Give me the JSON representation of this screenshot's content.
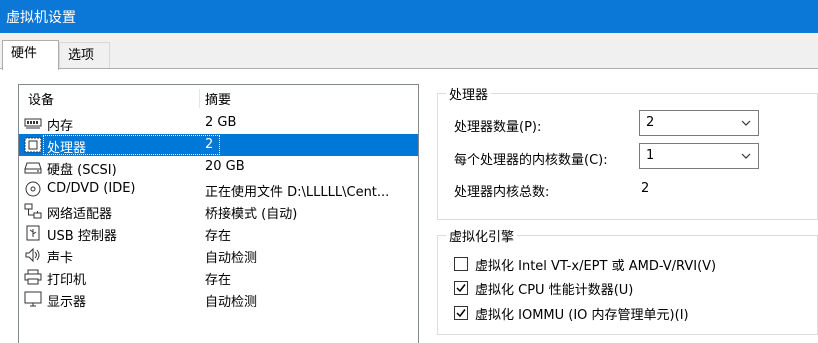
{
  "window": {
    "title": "虚拟机设置"
  },
  "tabs": [
    {
      "label": "硬件"
    },
    {
      "label": "选项"
    }
  ],
  "device_list": {
    "headers": {
      "device": "设备",
      "summary": "摘要"
    },
    "rows": [
      {
        "name": "内存",
        "summary": "2 GB",
        "icon": "memory-icon"
      },
      {
        "name": "处理器",
        "summary": "2",
        "icon": "processor-icon"
      },
      {
        "name": "硬盘 (SCSI)",
        "summary": "20 GB",
        "icon": "hard-disk-icon"
      },
      {
        "name": "CD/DVD (IDE)",
        "summary": "正在使用文件 D:\\LLLLL\\Cent...",
        "icon": "cd-dvd-icon"
      },
      {
        "name": "网络适配器",
        "summary": "桥接模式 (自动)",
        "icon": "network-adapter-icon"
      },
      {
        "name": "USB 控制器",
        "summary": "存在",
        "icon": "usb-controller-icon"
      },
      {
        "name": "声卡",
        "summary": "自动检测",
        "icon": "sound-card-icon"
      },
      {
        "name": "打印机",
        "summary": "存在",
        "icon": "printer-icon"
      },
      {
        "name": "显示器",
        "summary": "自动检测",
        "icon": "display-icon"
      }
    ],
    "selected_index": 1
  },
  "processor_group": {
    "title": "处理器",
    "processor_count_label": "处理器数量(P):",
    "processor_count_value": "2",
    "cores_per_processor_label": "每个处理器的内核数量(C):",
    "cores_per_processor_value": "1",
    "total_cores_label": "处理器内核总数:",
    "total_cores_value": "2"
  },
  "virtualization_group": {
    "title": "虚拟化引擎",
    "options": [
      {
        "label": "虚拟化 Intel VT-x/EPT 或 AMD-V/RVI(V)",
        "checked": false
      },
      {
        "label": "虚拟化 CPU 性能计数器(U)",
        "checked": true
      },
      {
        "label": "虚拟化 IOMMU (IO 内存管理单元)(I)",
        "checked": true
      }
    ]
  },
  "colors": {
    "titlebar": "#0b78d7",
    "selection": "#0078d7"
  }
}
